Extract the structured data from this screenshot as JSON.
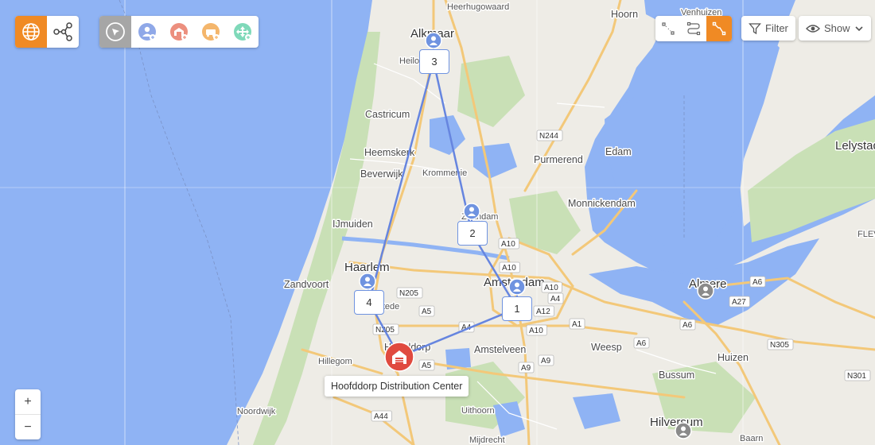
{
  "toolbar": {
    "view_mode": {
      "globe": "globe-icon",
      "network": "network-icon",
      "active": "globe"
    },
    "tools": [
      "pointer-icon",
      "add-customer-icon",
      "add-depot-icon",
      "add-vehicle-icon",
      "add-waypoint-icon"
    ],
    "route_style": {
      "options": [
        "dots-icon",
        "curved-route-icon",
        "straight-route-icon"
      ],
      "active": "straight-route-icon"
    },
    "filter_label": "Filter",
    "show_label": "Show"
  },
  "zoom": {
    "in": "+",
    "out": "−"
  },
  "map": {
    "cities_large": [
      "Alkmaar",
      "Haarlem",
      "Amsterdam",
      "Almere",
      "Hilversum",
      "Lelystad"
    ],
    "cities": [
      "Hoorn",
      "Purmerend",
      "Edam",
      "Heemskerk",
      "Beverwijk",
      "Castricum",
      "IJmuiden",
      "Zandvoort",
      "Amstelveen",
      "Monnickendam",
      "Weesp",
      "Huizen",
      "Bussum",
      "Hoofddorp"
    ],
    "towns": [
      "Heerhugowaard",
      "Venhuizen",
      "Heiloo",
      "Krommenie",
      "Zaandam",
      "Heemstede",
      "Hillegom",
      "Noordwijk",
      "Uithoorn",
      "Mijdrecht",
      "Baarn",
      "FLEV"
    ],
    "roads": [
      "N244",
      "A10",
      "A10",
      "A10",
      "A10",
      "A5",
      "A4",
      "A4",
      "A9",
      "A9",
      "A1",
      "A6",
      "A6",
      "A6",
      "A27",
      "N205",
      "N205",
      "A5",
      "A44",
      "N305",
      "N301",
      "A12"
    ]
  },
  "route": {
    "stops": [
      {
        "number": "1"
      },
      {
        "number": "2"
      },
      {
        "number": "3"
      },
      {
        "number": "4"
      }
    ],
    "depot_name": "Hoofddorp Distribution Center",
    "route_color": "#6685df",
    "stop_color": "#6f93e0",
    "depot_color": "#e04a3f",
    "inactive_marker_color": "#8a8a8a"
  },
  "colors": {
    "accent": "#f08a24",
    "water": "#8fb3f4",
    "land": "#eeece6",
    "green": "#c9e0b6"
  }
}
